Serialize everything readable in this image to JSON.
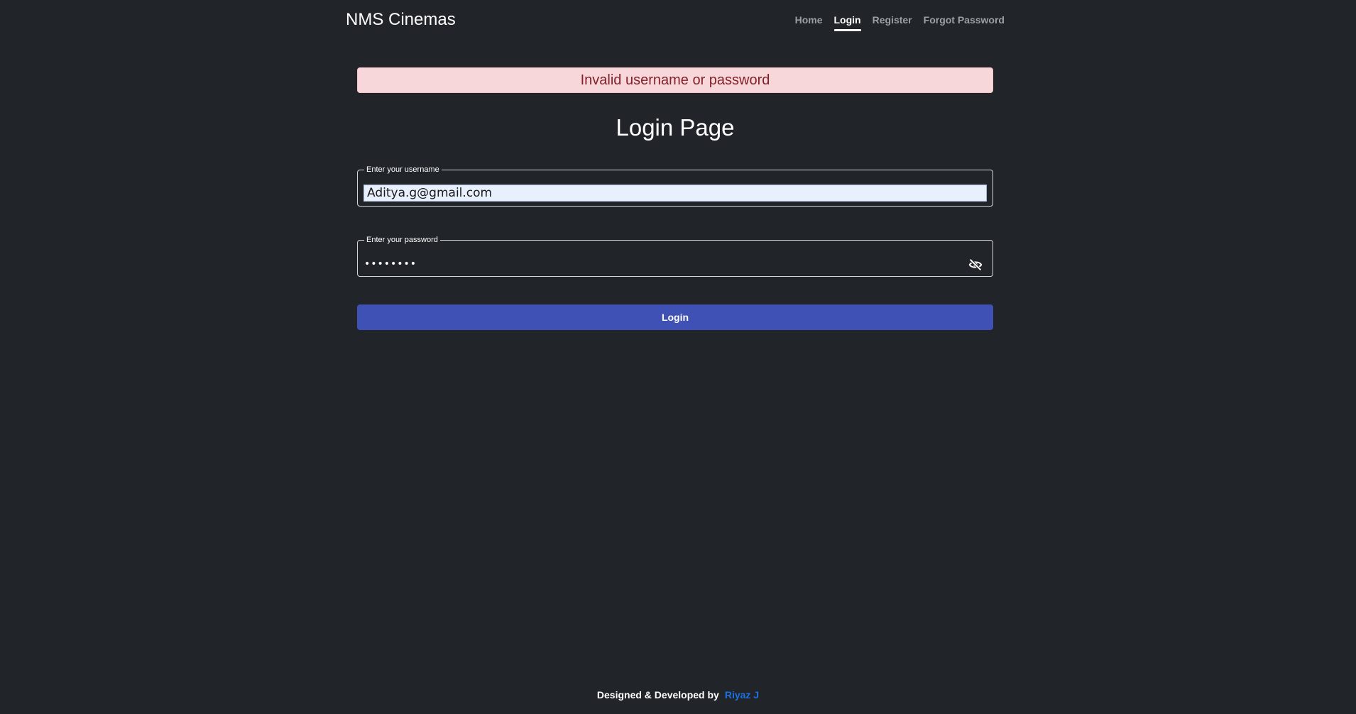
{
  "header": {
    "brand": "NMS Cinemas",
    "nav": [
      {
        "label": "Home",
        "active": false
      },
      {
        "label": "Login",
        "active": true
      },
      {
        "label": "Register",
        "active": false
      },
      {
        "label": "Forgot Password",
        "active": false
      }
    ]
  },
  "alert": {
    "message": "Invalid username or password"
  },
  "page_title": "Login Page",
  "form": {
    "username_legend": "Enter your username",
    "username_value": "Aditya.g@gmail.com",
    "password_legend": "Enter your password",
    "password_value": "••••••••",
    "password_toggle_icon": "eye-off-icon",
    "submit_label": "Login"
  },
  "footer": {
    "text": "Designed & Developed by",
    "author": "Riyaz J"
  },
  "colors": {
    "background": "#212529",
    "alert_bg": "#f8d7da",
    "alert_text": "#842029",
    "button": "#3f51b5",
    "author_link": "#1e6fe0"
  }
}
